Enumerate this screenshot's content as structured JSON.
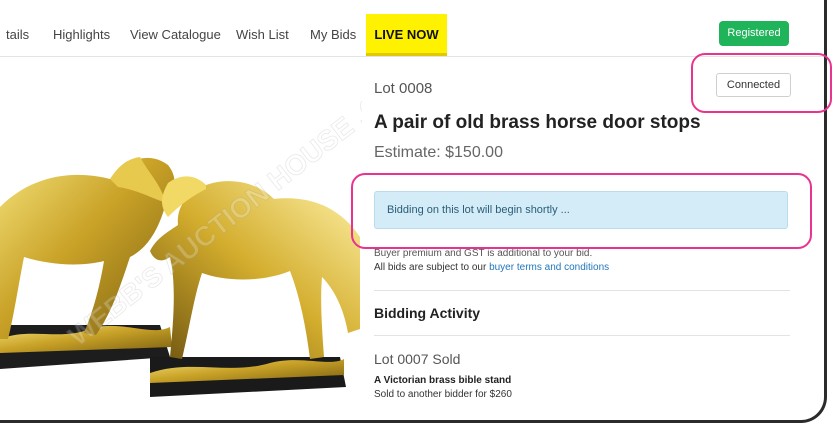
{
  "nav": {
    "items": [
      "tails",
      "Highlights",
      "View Catalogue",
      "Wish List",
      "My Bids"
    ],
    "live_label": "LIVE NOW",
    "registered_label": "Registered"
  },
  "lot": {
    "number": "Lot 0008",
    "title": "A pair of old brass horse door stops",
    "estimate": "Estimate: $150.00",
    "connection_status": "Connected",
    "notice": "Bidding on this lot will begin shortly ...",
    "premium_note": "Buyer premium and GST is additional to your bid.",
    "terms_prefix": "All bids are subject to our",
    "terms_link": "buyer terms and conditions"
  },
  "activity": {
    "heading": "Bidding Activity",
    "entries": [
      {
        "title": "Lot 0007 Sold",
        "lot_name": "A Victorian brass bible stand",
        "detail": "Sold to another bidder for $260"
      }
    ]
  },
  "image": {
    "watermark": "WEBB'S AUCTION HOUSE .CO.NZ"
  },
  "colors": {
    "live_bg": "#fff200",
    "registered_bg": "#1fb35a",
    "notice_bg": "#d4ecf7",
    "link": "#2277bb",
    "highlight": "#e8338f",
    "brass": "#c9a227"
  }
}
